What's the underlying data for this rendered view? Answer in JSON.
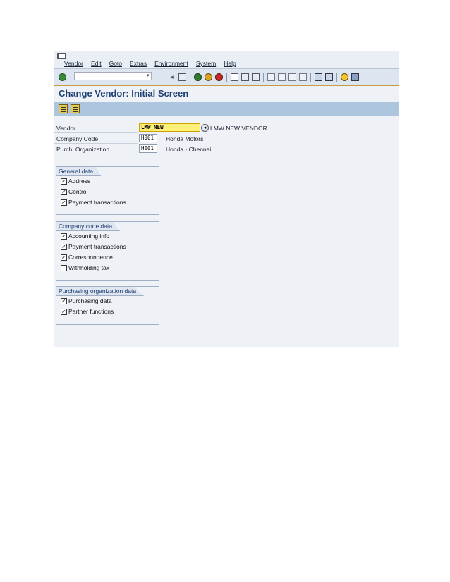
{
  "menubar": {
    "items": [
      "Vendor",
      "Edit",
      "Goto",
      "Extras",
      "Environment",
      "System",
      "Help"
    ]
  },
  "page": {
    "title": "Change Vendor:  Initial Screen"
  },
  "fields": [
    {
      "label": "Vendor",
      "value": "LMW_NEW",
      "description": "LMW NEW VENDOR"
    },
    {
      "label": "Company Code",
      "value": "H001",
      "description": "Honda Motors"
    },
    {
      "label": "Purch. Organization",
      "value": "H001",
      "description": "Honda - Chennai"
    }
  ],
  "groups": [
    {
      "title": "General data",
      "items": [
        {
          "label": "Address",
          "checked": true
        },
        {
          "label": "Control",
          "checked": true
        },
        {
          "label": "Payment transactions",
          "checked": true
        }
      ]
    },
    {
      "title": "Company code data",
      "items": [
        {
          "label": "Accounting info",
          "checked": true
        },
        {
          "label": "Payment transactions",
          "checked": true
        },
        {
          "label": "Correspondence",
          "checked": true
        },
        {
          "label": "Withholding tax",
          "checked": false
        }
      ]
    },
    {
      "title": "Purchasing organization data",
      "items": [
        {
          "label": "Purchasing data",
          "checked": true
        },
        {
          "label": "Partner functions",
          "checked": true
        }
      ]
    }
  ],
  "colors": {
    "title": "#1d3f72",
    "toolbar": "#dce5f0",
    "appbar": "#aec5de",
    "highlight": "#fff07a"
  }
}
